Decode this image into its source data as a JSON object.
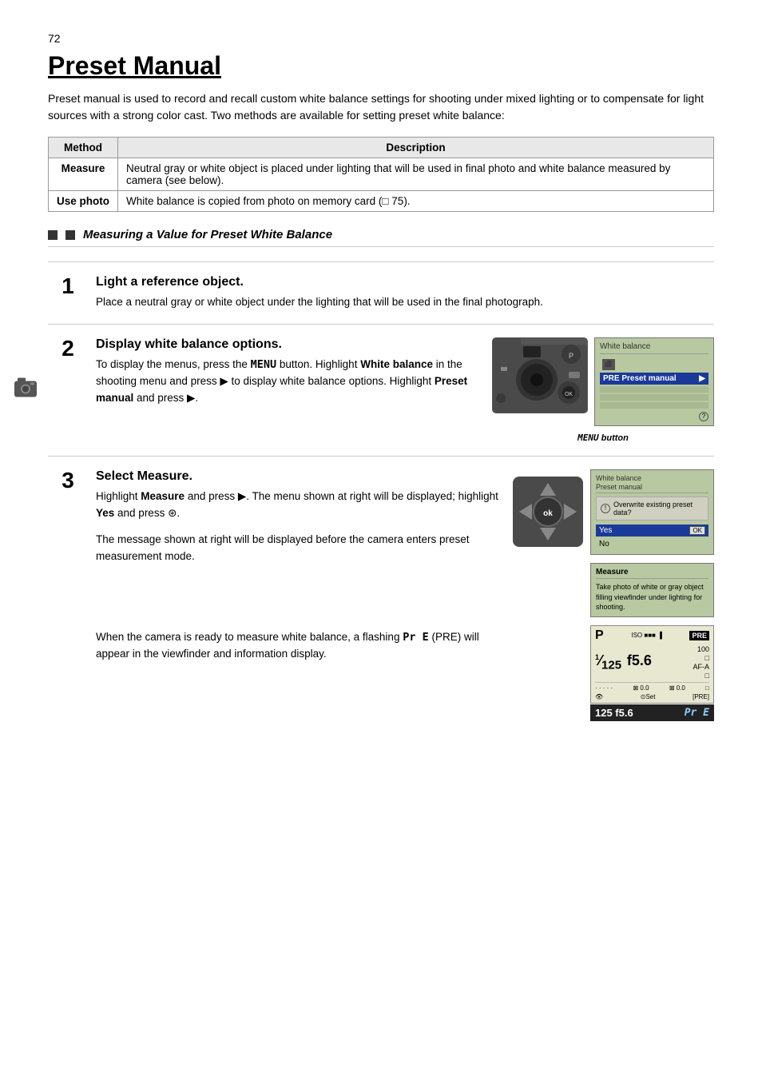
{
  "page": {
    "number": "72",
    "title": "Preset Manual"
  },
  "intro": "Preset manual is used to record and recall custom white balance settings for shooting under mixed lighting or to compensate for light sources with a strong color cast.  Two methods are available for setting preset white balance:",
  "table": {
    "headers": [
      "Method",
      "Description"
    ],
    "rows": [
      {
        "method": "Measure",
        "description": "Neutral gray or white object is placed under lighting that will be used in final photo and white balance measured by camera (see below)."
      },
      {
        "method": "Use photo",
        "description": "White balance is copied from photo on memory card (□ 75)."
      }
    ]
  },
  "section_heading": "Measuring a Value for Preset White Balance",
  "steps": [
    {
      "number": "1",
      "title": "Light a reference object.",
      "body": "Place a neutral gray or white object under the lighting that will be used in the final photograph."
    },
    {
      "number": "2",
      "title": "Display white balance options.",
      "body_parts": [
        "To display the menus, press the ",
        "MENU",
        " button. Highlight ",
        "White balance",
        " in the shooting menu and press ▶ to display white balance options.  Highlight ",
        "Preset manual",
        " and press ▶."
      ],
      "lcd": {
        "title": "White balance",
        "selected_item": "PRE  Preset manual"
      },
      "menu_label": "MENU button"
    },
    {
      "number": "3",
      "title": "Select Measure.",
      "body_parts": [
        "Highlight ",
        "Measure",
        " and press ▶.  The menu shown at right will be displayed; highlight ",
        "Yes",
        " and press ⊛."
      ],
      "extra_text_1": "The message shown at right will be displayed before the camera enters preset measurement mode.",
      "extra_text_2": "When the camera is ready to measure white balance, a flashing ",
      "pre_text": "Pr E",
      "extra_text_3": " (PRE) will appear in the viewfinder and information display.",
      "dialog": {
        "title1": "White balance",
        "title2": "Preset manual",
        "warning": "Overwrite existing preset data?",
        "option_yes": "Yes",
        "option_no": "No",
        "ok_label": "OK"
      },
      "measure_box": {
        "title": "Measure",
        "text": "Take photo of white or gray object filling viewfinder under lighting for shooting."
      },
      "viewfinder": {
        "mode": "P",
        "iso_label": "ISO",
        "pre_badge": "PRE",
        "shutter": "¹⁄125",
        "aperture": "f5.6",
        "iso_value": "100",
        "af_label": "AF-A",
        "ev_label": "±0.0",
        "ev2_label": "±0.0",
        "set_label": "Set",
        "pre_indicator": "[PRE]",
        "bottom_shutter": "125",
        "bottom_aperture": "f5.6",
        "bottom_pre": "Pr E"
      }
    }
  ]
}
